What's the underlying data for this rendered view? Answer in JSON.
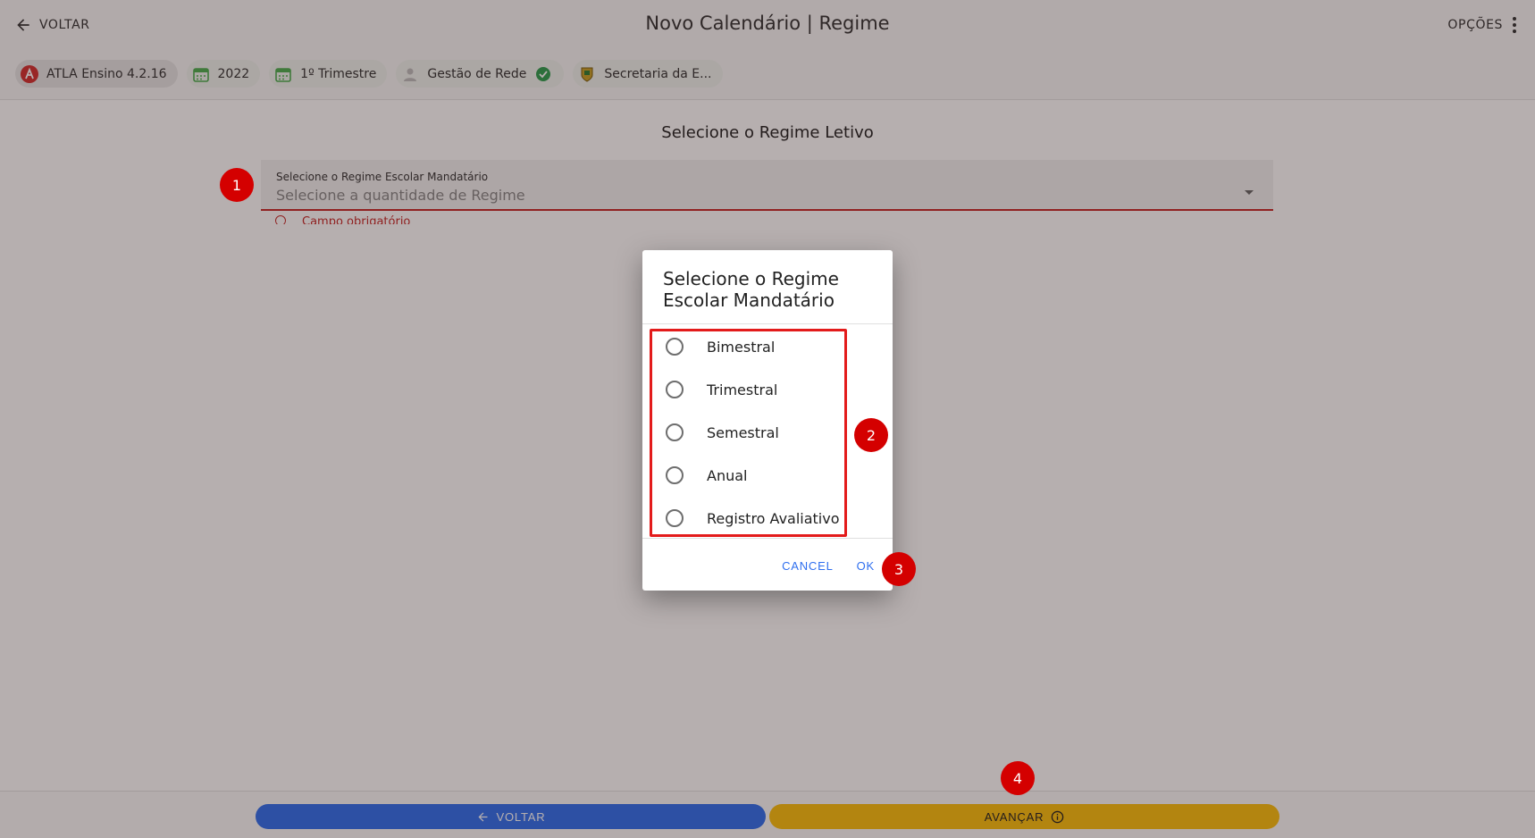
{
  "header": {
    "back_label": "VOLTAR",
    "title": "Novo Calendário | Regime",
    "options_label": "OPÇÕES"
  },
  "chips": [
    {
      "label": "ATLA Ensino 4.2.16",
      "icon": "atla-logo-icon"
    },
    {
      "label": "2022",
      "icon": "calendar-icon"
    },
    {
      "label": "1º Trimestre",
      "icon": "calendar-icon"
    },
    {
      "label": "Gestão de Rede",
      "icon": "user-icon",
      "badge": "check-circle-icon"
    },
    {
      "label": "Secretaria da E...",
      "icon": "emblem-icon"
    }
  ],
  "content": {
    "title": "Selecione o Regime Letivo",
    "field_label": "Selecione o Regime Escolar Mandatário",
    "field_placeholder": "Selecione a quantidade de Regime",
    "field_error": "Campo obrigatório"
  },
  "dialog": {
    "title": "Selecione o Regime Escolar Mandatário",
    "options": [
      "Bimestral",
      "Trimestral",
      "Semestral",
      "Anual",
      "Registro Avaliativo"
    ],
    "cancel_label": "CANCEL",
    "ok_label": "OK"
  },
  "footer": {
    "back_label": "VOLTAR",
    "next_label": "AVANÇAR"
  },
  "markers": [
    "1",
    "2",
    "3",
    "4"
  ],
  "colors": {
    "primary_blue": "#2f6fef",
    "accent_yellow": "#fbbf0f",
    "error_red": "#c62828",
    "marker_red": "#d40000",
    "highlight_red": "#e31b1b"
  }
}
